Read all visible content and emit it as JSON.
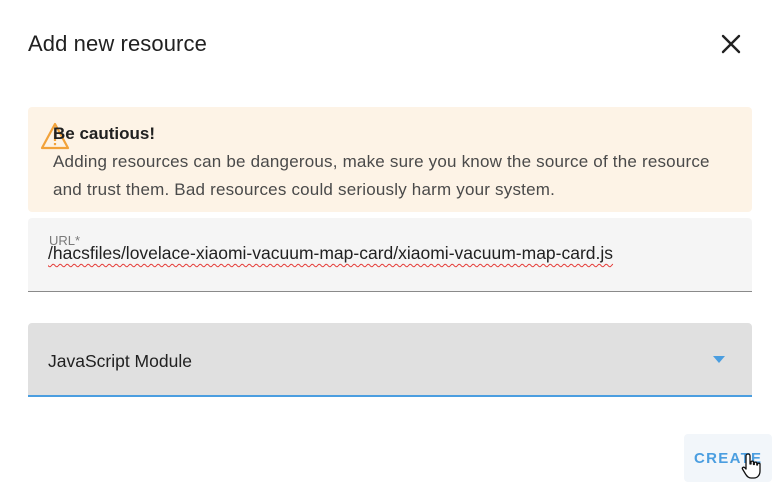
{
  "dialog": {
    "title": "Add new resource",
    "close_icon": "close-icon"
  },
  "alert": {
    "icon": "warning-icon",
    "title": "Be cautious!",
    "body": "Adding resources can be dangerous, make sure you know the source of the resource and trust them. Bad resources could seriously harm your system.",
    "background": "#fdf3e6",
    "icon_color": "#f2a23a"
  },
  "url_field": {
    "label": "URL*",
    "value": "/hacsfiles/lovelace-xiaomi-vacuum-map-card/xiaomi-vacuum-map-card.js"
  },
  "type_select": {
    "selected": "JavaScript Module",
    "arrow_icon": "arrow-drop-down-icon",
    "accent": "#4b9ee0"
  },
  "actions": {
    "create_label": "CREATE"
  },
  "cursor": {
    "icon": "hand-pointer-cursor-icon"
  }
}
